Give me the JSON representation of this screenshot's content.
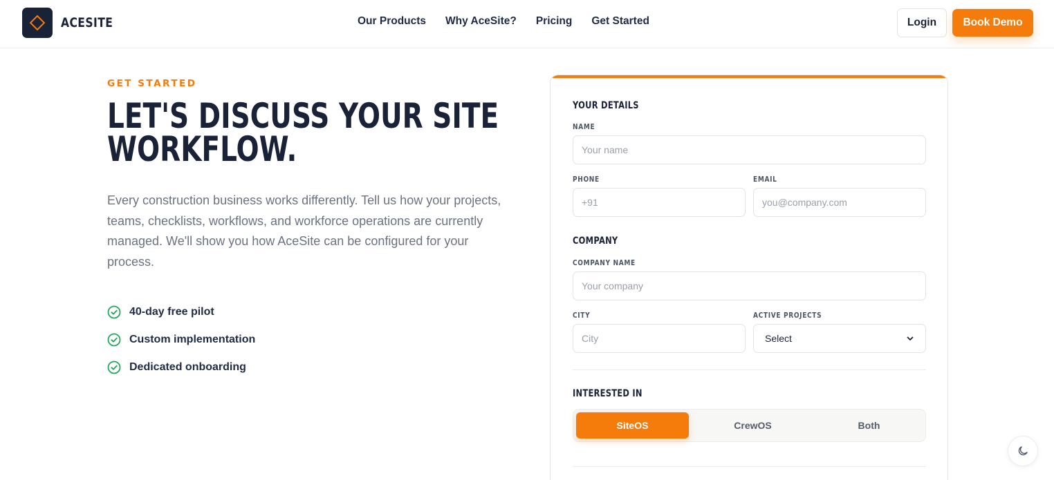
{
  "brand": {
    "name": "ACESITE",
    "accent": "#f47c0f",
    "dark": "#1a2238"
  },
  "nav": {
    "links": [
      "Our Products",
      "Why AceSite?",
      "Pricing",
      "Get Started"
    ],
    "login": "Login",
    "book_demo": "Book Demo"
  },
  "hero": {
    "eyebrow": "GET STARTED",
    "headline_line1": "LET'S DISCUSS YOUR SITE",
    "headline_line2": "WORKFLOW.",
    "lead": "Every construction business works differently. Tell us how your projects, teams, checklists, workflows, and workforce operations are currently managed. We'll show you how AceSite can be configured for your process.",
    "features": [
      "40-day free pilot",
      "Custom implementation",
      "Dedicated onboarding"
    ]
  },
  "form": {
    "details_title": "YOUR DETAILS",
    "name_label": "NAME",
    "name_placeholder": "Your name",
    "phone_label": "PHONE",
    "phone_placeholder": "+91",
    "email_label": "EMAIL",
    "email_placeholder": "you@company.com",
    "company_title": "COMPANY",
    "company_label": "COMPANY NAME",
    "company_placeholder": "Your company",
    "city_label": "CITY",
    "city_placeholder": "City",
    "projects_label": "ACTIVE PROJECTS",
    "projects_value": "Select",
    "interest_title": "INTERESTED IN",
    "interest_options": [
      "SiteOS",
      "CrewOS",
      "Both"
    ],
    "interest_selected": "SiteOS"
  },
  "icons": {
    "check": "check-circle-icon",
    "chevron": "chevron-down-icon",
    "theme": "moon-icon",
    "logo": "diamond-icon"
  }
}
